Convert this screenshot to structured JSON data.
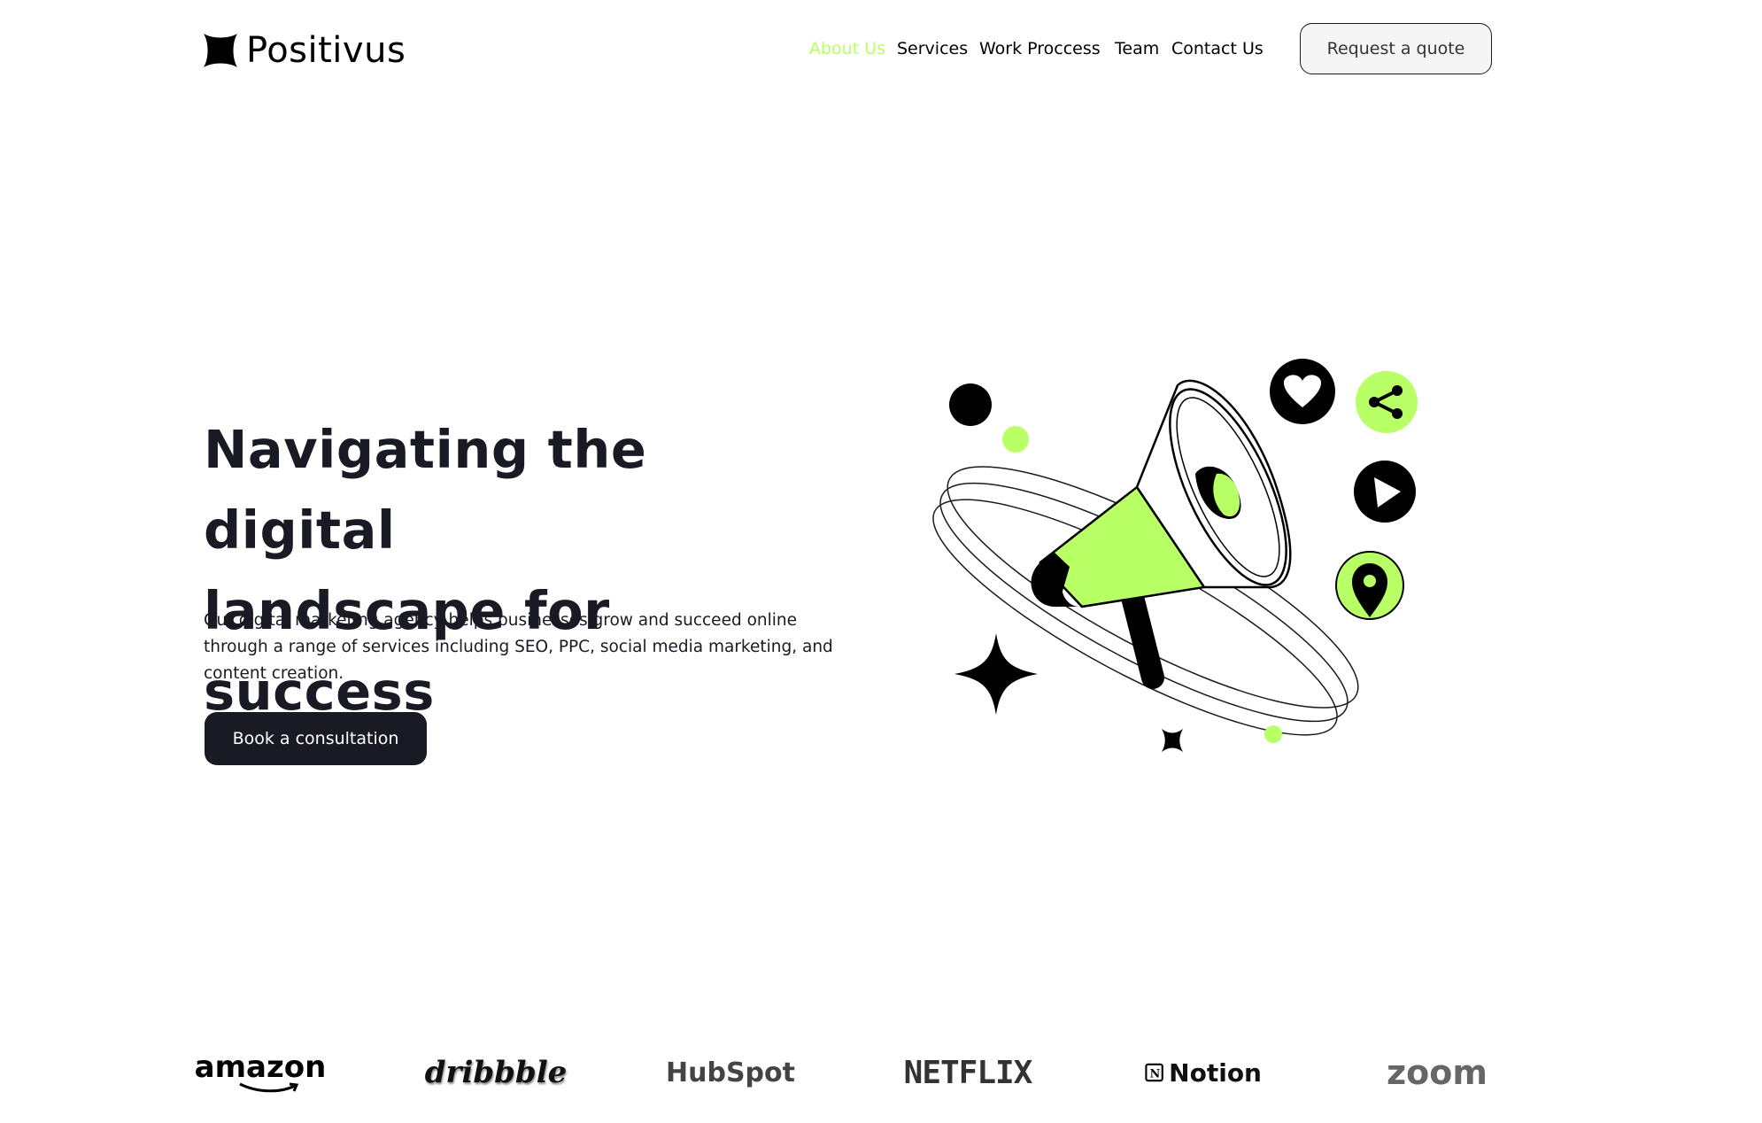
{
  "header": {
    "brand_name": "Positivus",
    "nav": [
      {
        "label": "About Us",
        "active": true
      },
      {
        "label": "Services",
        "active": false
      },
      {
        "label": "Work Proccess",
        "active": false
      },
      {
        "label": "Team",
        "active": false
      },
      {
        "label": "Contact Us",
        "active": false
      }
    ],
    "quote_button": "Request a quote"
  },
  "hero": {
    "title_line1": "Navigating the digital",
    "title_line2": "landscape for success",
    "description": "Our digital marketing agency helps businesses grow and succeed online through a range of services including SEO, PPC, social media marketing, and content creation.",
    "cta": "Book a consultation",
    "illustration_icons": [
      "megaphone-icon",
      "heart-icon",
      "share-icon",
      "play-icon",
      "location-pin-icon",
      "sparkle-star-icon"
    ]
  },
  "clients": [
    {
      "name": "amazon"
    },
    {
      "name": "dribbble"
    },
    {
      "name": "HubSpot"
    },
    {
      "name": "NETFLIX"
    },
    {
      "name": "Notion"
    },
    {
      "name": "zoom"
    }
  ],
  "colors": {
    "accent_green": "#b9ff66",
    "dark": "#191a23",
    "background": "#ffffff"
  }
}
